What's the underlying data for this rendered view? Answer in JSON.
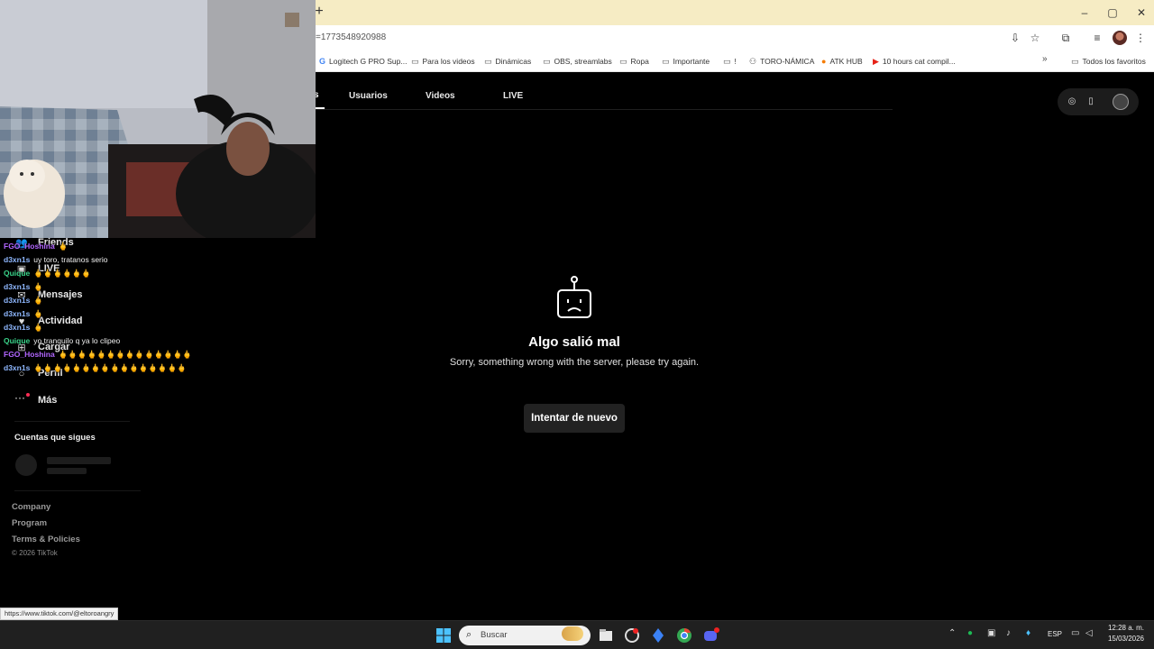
{
  "browser": {
    "url_fragment": "=1773548920988",
    "new_tab_symbol": "+",
    "window_controls": [
      "–",
      "▢",
      "✕"
    ],
    "bookmarks": [
      {
        "label": "Logitech G PRO Sup...",
        "icon": "google-icon"
      },
      {
        "label": "Para los videos",
        "icon": "folder-icon"
      },
      {
        "label": "Dinámicas",
        "icon": "folder-icon"
      },
      {
        "label": "OBS, streamlabs",
        "icon": "folder-icon"
      },
      {
        "label": "Ropa",
        "icon": "folder-icon"
      },
      {
        "label": "Importante",
        "icon": "folder-icon"
      },
      {
        "label": "!",
        "icon": "folder-icon"
      },
      {
        "label": "TORO-NÁMICA",
        "icon": "link-icon"
      },
      {
        "label": "ATK HUB",
        "icon": "orange-circle-icon"
      },
      {
        "label": "10 hours cat compil...",
        "icon": "youtube-icon"
      }
    ],
    "bookmarks_more": "»",
    "all_bookmarks": "Todos los favoritos",
    "status_url": "https://www.tiktok.com/@eltoroangry"
  },
  "tiktok": {
    "tab_fragment": "s",
    "tabs": [
      "Usuarios",
      "Videos",
      "LIVE"
    ],
    "error": {
      "title": "Algo salió mal",
      "message": "Sorry, something wrong with the server, please try again.",
      "retry_label": "Intentar de nuevo"
    },
    "sidebar": {
      "items": [
        {
          "label": "Friends",
          "icon": "friends-icon"
        },
        {
          "label": "LIVE",
          "icon": "live-icon"
        },
        {
          "label": "Mensajes",
          "icon": "message-icon"
        },
        {
          "label": "Actividad",
          "icon": "activity-icon"
        },
        {
          "label": "Cargar",
          "icon": "upload-icon"
        },
        {
          "label": "Perfil",
          "icon": "profile-icon"
        },
        {
          "label": "Más",
          "icon": "more-icon"
        }
      ],
      "following_title": "Cuentas que sigues",
      "footer_links": [
        "Company",
        "Program",
        "Terms & Policies"
      ],
      "copyright": "© 2026 TikTok"
    }
  },
  "chat": {
    "messages": [
      {
        "user": "FGO_Hoshina",
        "color": "#b266ff",
        "text": "🖕"
      },
      {
        "user": "d3xn1s",
        "color": "#8fb8ff",
        "text": "uy toro, tratanos serio"
      },
      {
        "user": "Quique",
        "color": "#3ad48a",
        "text": "🖕🖕🖕🖕🖕🖕"
      },
      {
        "user": "d3xn1s",
        "color": "#8fb8ff",
        "text": "🖕"
      },
      {
        "user": "d3xn1s",
        "color": "#8fb8ff",
        "text": "🖕"
      },
      {
        "user": "d3xn1s",
        "color": "#8fb8ff",
        "text": "🖕"
      },
      {
        "user": "d3xn1s",
        "color": "#8fb8ff",
        "text": "🖕"
      },
      {
        "user": "Quique",
        "color": "#3ad48a",
        "text": "yo tranquilo q ya lo clipeo"
      },
      {
        "user": "FGO_Hoshina",
        "color": "#b266ff",
        "text": "🖕🖕🖕🖕🖕🖕🖕🖕🖕🖕🖕🖕🖕🖕"
      },
      {
        "user": "d3xn1s",
        "color": "#8fb8ff",
        "text": "🖕🖕🖕🖕🖕🖕🖕🖕🖕🖕🖕🖕🖕🖕🖕🖕"
      }
    ]
  },
  "taskbar": {
    "search_placeholder": "Buscar",
    "language": "ESP",
    "time": "12:28 a. m.",
    "date": "15/03/2026"
  },
  "colors": {
    "titlebar": "#f6ecc4",
    "page_bg": "#000000",
    "button_bg": "#222222",
    "tiktok_accent": "#fe2c55"
  }
}
